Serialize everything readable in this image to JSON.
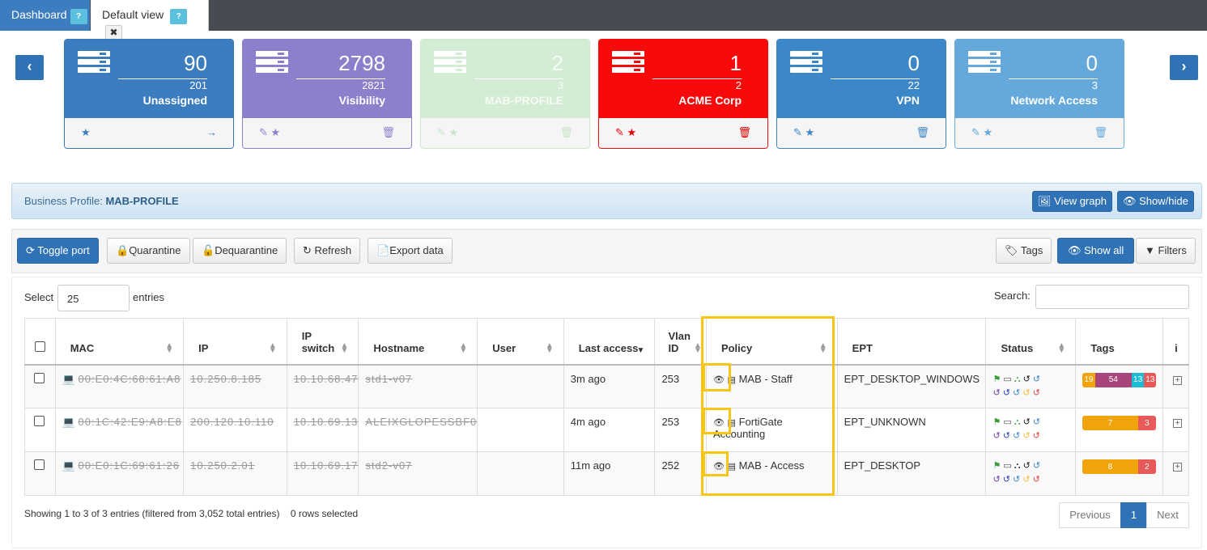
{
  "tabs": {
    "dashboard": "Dashboard",
    "default_view": "Default view",
    "help": "?",
    "close": "✖"
  },
  "nav": {
    "prev": "‹",
    "next": "›"
  },
  "cards": [
    {
      "value": "90",
      "total": "201",
      "name": "Unassigned",
      "bg": "#3c7dc0",
      "border": "#3a78b5",
      "accent": "#3c7dc0",
      "fade": false
    },
    {
      "value": "2798",
      "total": "2821",
      "name": "Visibility",
      "bg": "#8e7fcc",
      "border": "#8e7fcc",
      "accent": "#8e7fcc",
      "fade": false
    },
    {
      "value": "2",
      "total": "3",
      "name": "MAB-PROFILE",
      "bg": "#d4ecd4",
      "border": "#cde8cd",
      "accent": "#c7e6c7",
      "fade": true
    },
    {
      "value": "1",
      "total": "2",
      "name": "ACME Corp",
      "bg": "#f70a0a",
      "border": "#f70a0a",
      "accent": "#e60000",
      "fade": false
    },
    {
      "value": "0",
      "total": "22",
      "name": "VPN",
      "bg": "#3c87c8",
      "border": "#3c87c8",
      "accent": "#3c87c8",
      "fade": false
    },
    {
      "value": "0",
      "total": "3",
      "name": "Network Access",
      "bg": "#65a9dc",
      "border": "#65a9dc",
      "accent": "#65a9dc",
      "fade": false
    }
  ],
  "business_profile": {
    "label": "Business Profile:",
    "name": "MAB-PROFILE",
    "view_graph": "View graph",
    "show_hide": "Show/hide"
  },
  "toolbar": {
    "toggle_port": "Toggle port",
    "quarantine": "Quarantine",
    "dequarantine": "Dequarantine",
    "refresh": "Refresh",
    "export": "Export data",
    "tags": "Tags",
    "show_all": "Show all",
    "filters": "Filters"
  },
  "table_controls": {
    "select": "Select",
    "page_size": "25",
    "entries": "entries",
    "search": "Search:"
  },
  "columns": {
    "mac": "MAC",
    "ip": "IP",
    "ip_switch_1": "IP",
    "ip_switch_2": "switch",
    "hostname": "Hostname",
    "user": "User",
    "last_access": "Last access",
    "vlan_1": "Vlan",
    "vlan_2": "ID",
    "policy": "Policy",
    "ept": "EPT",
    "status": "Status",
    "tags": "Tags",
    "info": "i"
  },
  "rows": [
    {
      "mac": "00:E0:4C:68:61:A8",
      "ip": "10.250.8.185",
      "ip_switch": "10.10.68.47",
      "hostname": "std1-v07",
      "user": "",
      "last_access": "3m ago",
      "vlan": "253",
      "policy": "MAB - Staff",
      "ept": "EPT_DESKTOP_WINDOWS",
      "tags": [
        {
          "v": "19",
          "c": "#f0a30a"
        },
        {
          "v": "54",
          "c": "#a8457a"
        },
        {
          "v": "13",
          "c": "#1bbcd4"
        },
        {
          "v": "13",
          "c": "#e85a5a"
        }
      ]
    },
    {
      "mac": "00:1C:42:E9:A8:E8",
      "ip": "200.120.10.110",
      "ip_switch": "10.10.69.13",
      "hostname": "ALEIXGLOPESSBF0",
      "user": "",
      "last_access": "4m ago",
      "vlan": "253",
      "policy": "FortiGate Accounting",
      "ept": "EPT_UNKNOWN",
      "tags": [
        {
          "v": "7",
          "c": "#f0a30a"
        },
        {
          "v": "3",
          "c": "#e85a5a"
        }
      ]
    },
    {
      "mac": "00:E0:1C:69:61:26",
      "ip": "10.250.2.01",
      "ip_switch": "10.10.69.17",
      "hostname": "std2-v07",
      "user": "",
      "last_access": "11m ago",
      "vlan": "252",
      "policy": "MAB - Access",
      "ept": "EPT_DESKTOP",
      "tags": [
        {
          "v": "8",
          "c": "#f0a30a"
        },
        {
          "v": "2",
          "c": "#e85a5a"
        }
      ]
    }
  ],
  "footer": {
    "info": "Showing 1 to 3 of 3 entries (filtered from 3,052 total entries)",
    "selected": "0 rows selected",
    "previous": "Previous",
    "page": "1",
    "next": "Next"
  }
}
